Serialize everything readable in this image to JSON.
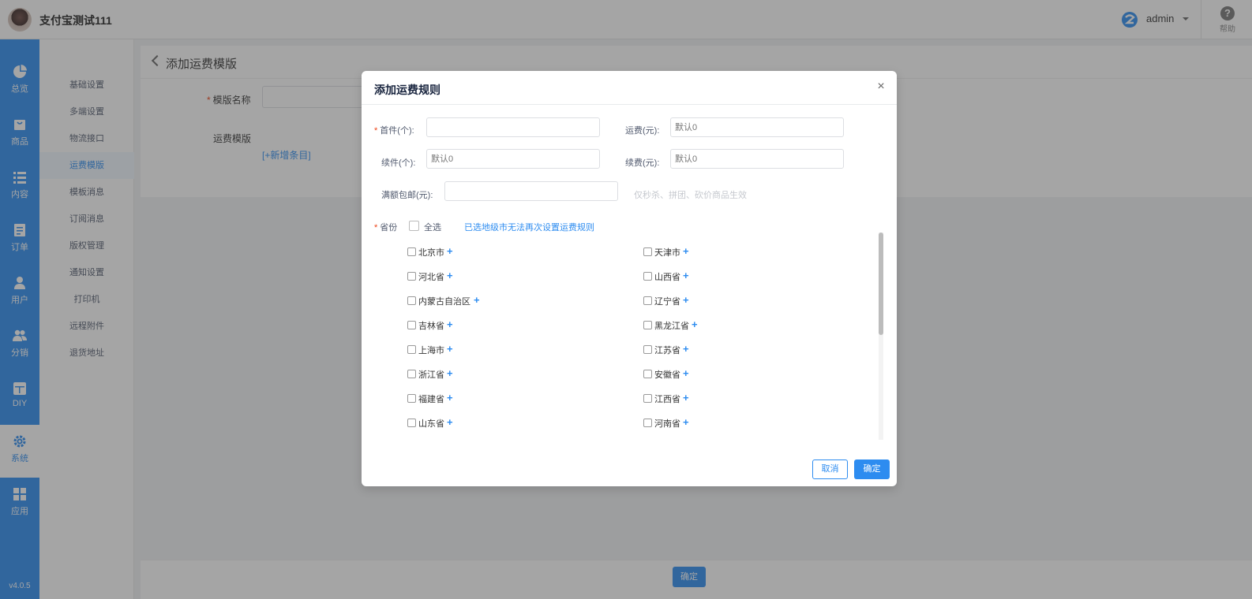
{
  "header": {
    "shop_name": "支付宝测试111",
    "user_name": "admin",
    "help_label": "帮助"
  },
  "sidebar": {
    "items": [
      {
        "label": "总览",
        "icon": "pie-chart-icon"
      },
      {
        "label": "商品",
        "icon": "bag-icon"
      },
      {
        "label": "内容",
        "icon": "list-icon"
      },
      {
        "label": "订单",
        "icon": "order-icon"
      },
      {
        "label": "用户",
        "icon": "user-icon"
      },
      {
        "label": "分销",
        "icon": "users-icon"
      },
      {
        "label": "DIY",
        "icon": "layout-icon"
      },
      {
        "label": "系统",
        "icon": "gear-icon"
      },
      {
        "label": "应用",
        "icon": "grid-icon"
      }
    ],
    "active": "系统",
    "version": "v4.0.5"
  },
  "submenu": {
    "items": [
      "基础设置",
      "多端设置",
      "物流接口",
      "运费模版",
      "模板消息",
      "订阅消息",
      "版权管理",
      "通知设置",
      "打印机",
      "远程附件",
      "退货地址"
    ],
    "active": "运费模版"
  },
  "page": {
    "title": "添加运费模版",
    "name_label": "模版名称",
    "template_label": "运费模版",
    "add_entry": "[+新增条目]",
    "confirm": "确定"
  },
  "modal": {
    "title": "添加运费规则",
    "close": "×",
    "first_piece_label": "首件(个):",
    "freight_label": "运费(元):",
    "freight_placeholder": "默认0",
    "next_piece_label": "续件(个):",
    "next_piece_placeholder": "默认0",
    "next_fee_label": "续费(元):",
    "next_fee_placeholder": "默认0",
    "free_shipping_label": "满额包邮(元):",
    "free_shipping_tip": "仅秒杀、拼团、砍价商品生效",
    "province_label": "省份",
    "select_all": "全选",
    "region_note": "已选地级市无法再次设置运费规则",
    "provinces": [
      "北京市",
      "天津市",
      "河北省",
      "山西省",
      "内蒙古自治区",
      "辽宁省",
      "吉林省",
      "黑龙江省",
      "上海市",
      "江苏省",
      "浙江省",
      "安徽省",
      "福建省",
      "江西省",
      "山东省",
      "河南省"
    ],
    "cancel": "取消",
    "ok": "确定"
  },
  "colors": {
    "primary": "#2d8cf0",
    "required": "#ed4014"
  }
}
